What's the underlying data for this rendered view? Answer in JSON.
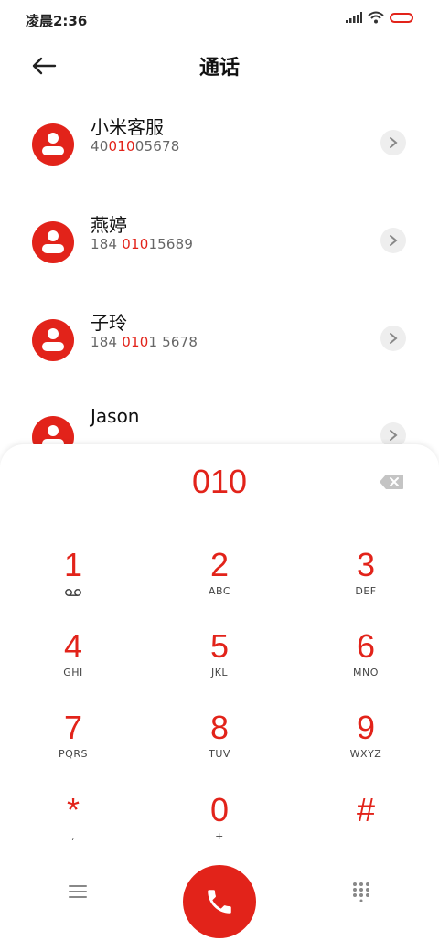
{
  "status_bar": {
    "time": "凌晨2:36"
  },
  "header": {
    "title": "通话"
  },
  "contacts": [
    {
      "name": "小米客服",
      "num_pre": "40",
      "num_hl": "010",
      "num_post": "05678"
    },
    {
      "name": "燕婷",
      "num_pre": "184 ",
      "num_hl": "010",
      "num_post": "15689"
    },
    {
      "name": "子玲",
      "num_pre": "184 ",
      "num_hl": "010",
      "num_post": "1 5678"
    },
    {
      "name": "Jason",
      "num_pre": "",
      "num_hl": "",
      "num_post": ""
    }
  ],
  "dialpad": {
    "number": "010",
    "keys": [
      {
        "digit": "1",
        "letters": ""
      },
      {
        "digit": "2",
        "letters": "ABC"
      },
      {
        "digit": "3",
        "letters": "DEF"
      },
      {
        "digit": "4",
        "letters": "GHI"
      },
      {
        "digit": "5",
        "letters": "JKL"
      },
      {
        "digit": "6",
        "letters": "MNO"
      },
      {
        "digit": "7",
        "letters": "PQRS"
      },
      {
        "digit": "8",
        "letters": "TUV"
      },
      {
        "digit": "9",
        "letters": "WXYZ"
      },
      {
        "digit": "*",
        "letters": ","
      },
      {
        "digit": "0",
        "letters": "+"
      },
      {
        "digit": "#",
        "letters": ""
      }
    ]
  },
  "colors": {
    "accent": "#e2231a",
    "grey_button": "#eeeeee"
  },
  "icons": {
    "back": "back-arrow-icon",
    "signal": "signal-icon",
    "wifi": "wifi-icon",
    "battery": "battery-icon",
    "voicemail": "voicemail-icon",
    "backspace": "backspace-icon",
    "phone": "phone-icon",
    "menu": "menu-icon",
    "keypad": "keypad-icon",
    "chevron": "chevron-right-icon",
    "contact": "contact-avatar-icon"
  }
}
